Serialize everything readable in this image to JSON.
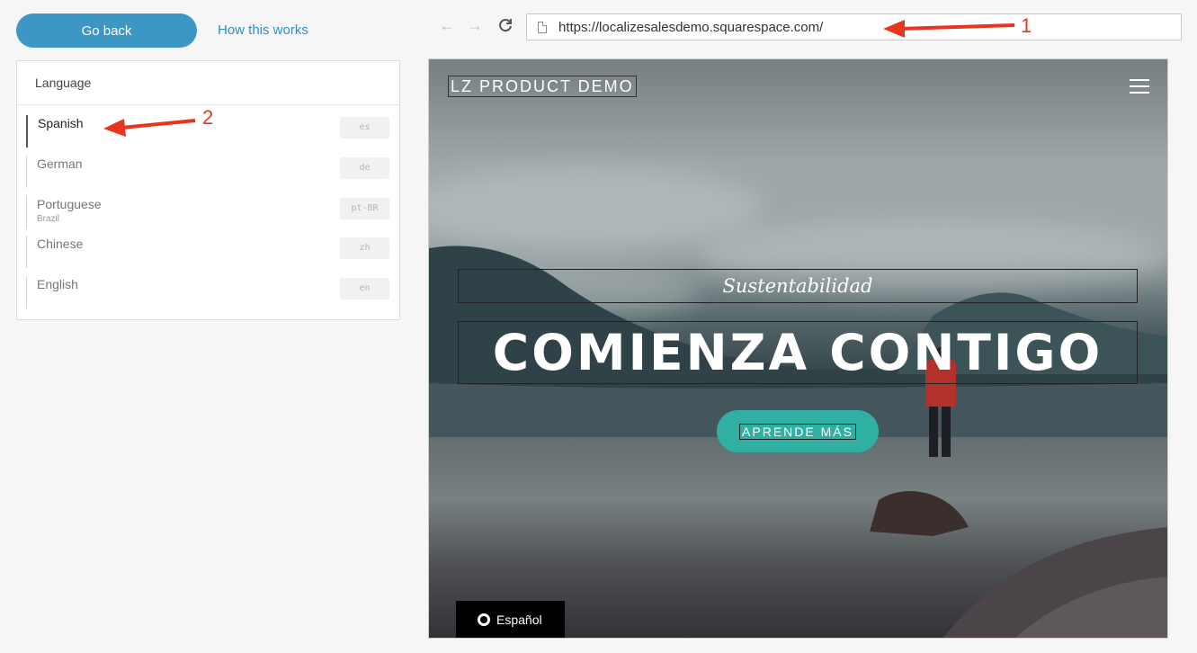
{
  "top": {
    "go_back": "Go back",
    "how_this_works": "How this works"
  },
  "language_panel": {
    "title": "Language",
    "items": [
      {
        "name": "Spanish",
        "sub": "",
        "code": "es"
      },
      {
        "name": "German",
        "sub": "",
        "code": "de"
      },
      {
        "name": "Portuguese",
        "sub": "Brazil",
        "code": "pt-BR"
      },
      {
        "name": "Chinese",
        "sub": "",
        "code": "zh"
      },
      {
        "name": "English",
        "sub": "",
        "code": "en"
      }
    ]
  },
  "browser": {
    "back_icon": "arrow-left-icon",
    "forward_icon": "arrow-right-icon",
    "refresh_icon": "refresh-icon",
    "url": "https://localizesalesdemo.squarespace.com/"
  },
  "preview": {
    "brand": "LZ PRODUCT DEMO",
    "subtitle": "Sustentabilidad",
    "headline": "COMIENZA CONTIGO",
    "cta": "APRENDE MÁS",
    "language_switch": "Español"
  },
  "annotations": {
    "one": "1",
    "two": "2",
    "color": "#e8351f"
  },
  "colors": {
    "accent_blue": "#3d97c4",
    "link_blue": "#2e8fc3",
    "cta_teal": "#2fb0a2"
  }
}
